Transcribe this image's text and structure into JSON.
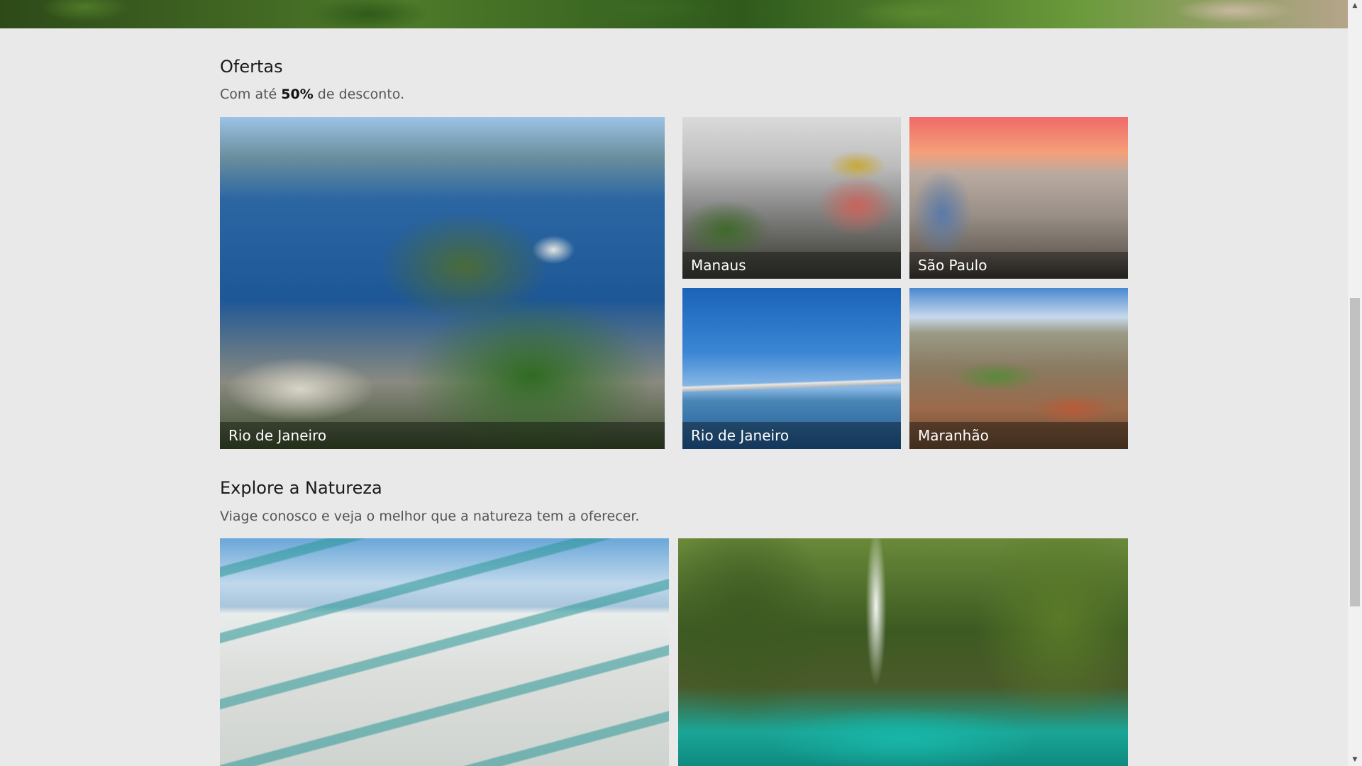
{
  "ofertas": {
    "title": "Ofertas",
    "subtitle_before": "Com até ",
    "subtitle_highlight": "50%",
    "subtitle_after": " de desconto.",
    "tiles": [
      {
        "label": "Rio de Janeiro"
      },
      {
        "label": "Manaus"
      },
      {
        "label": "São Paulo"
      },
      {
        "label": "Rio de Janeiro"
      },
      {
        "label": "Maranhão"
      }
    ]
  },
  "natureza": {
    "title": "Explore a Natureza",
    "subtitle": "Viage conosco e veja o melhor que a natureza tem a oferecer."
  },
  "scrollbar": {
    "up_icon": "▲",
    "down_icon": "▼"
  }
}
